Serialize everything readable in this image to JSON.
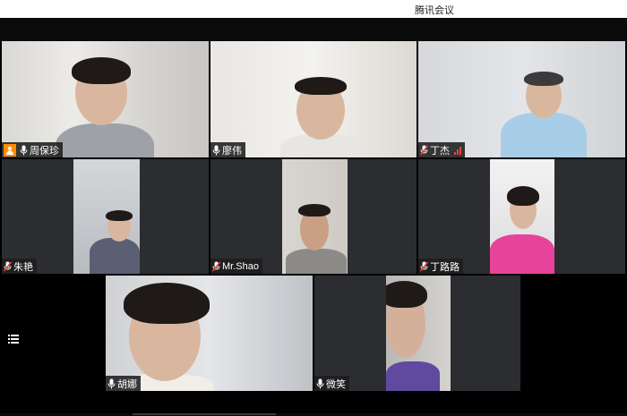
{
  "window": {
    "title": "腾讯会议"
  },
  "participants": [
    {
      "name": "周保珍",
      "muted": false,
      "host": true,
      "active_speaker": true
    },
    {
      "name": "廖伟",
      "muted": false
    },
    {
      "name": "丁杰",
      "muted": true,
      "signal": "weak"
    },
    {
      "name": "朱艳",
      "muted": true
    },
    {
      "name": "Mr.Shao",
      "muted": true
    },
    {
      "name": "丁路路",
      "muted": true
    },
    {
      "name": "胡娜",
      "muted": false
    },
    {
      "name": "微笑",
      "muted": false
    }
  ],
  "icons": {
    "menu": "list-icon",
    "mic": "microphone-icon",
    "mic_muted": "microphone-muted-icon",
    "host": "person-icon",
    "signal": "signal-bars-icon"
  },
  "colors": {
    "active_border": "#37c26b",
    "muted_red": "#e0473c",
    "host_badge": "#ff8a00",
    "tile_bg": "#2b2d31"
  }
}
